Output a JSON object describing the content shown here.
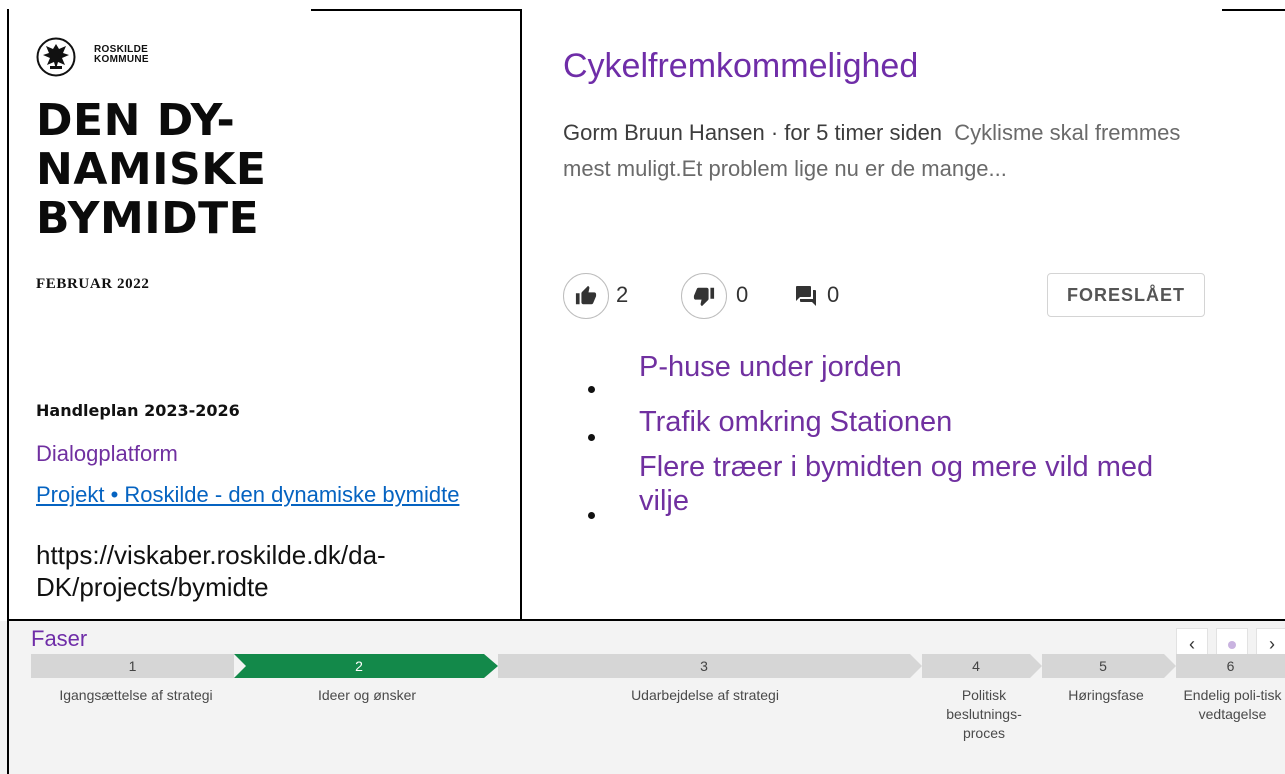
{
  "left": {
    "logo_text_line1": "ROSKILDE",
    "logo_text_line2": "KOMMUNE",
    "title_line1": "DEN DY-",
    "title_line2": "NAMISKE",
    "title_line3": "BYMIDTE",
    "date": "FEBRUAR 2022",
    "handleplan": "Handleplan 2023-2026",
    "dialog": "Dialogplatform",
    "project_link": "Projekt • Roskilde - den dynamiske bymidte",
    "url": "https://viskaber.roskilde.dk/da-DK/projects/bymidte"
  },
  "idea_card": {
    "title": "Cykelfremkommelighed",
    "author": "Gorm Bruun Hansen · for 5 timer siden",
    "excerpt": "Cyklisme skal fremmes mest muligt.Et problem lige nu er de mange...",
    "likes": "2",
    "dislikes": "0",
    "comments": "0",
    "status": "FORESLÅET"
  },
  "ideas": [
    "P-huse under jorden",
    "Trafik omkring Stationen",
    "Flere træer i bymidten og mere vild med vilje"
  ],
  "phases": {
    "title": "Faser",
    "nav_prev": "‹",
    "nav_next": "›",
    "items": [
      {
        "num": "1",
        "label": "Igangsættelse af strategi"
      },
      {
        "num": "2",
        "label": "Ideer og ønsker"
      },
      {
        "num": "3",
        "label": "Udarbejdelse af strategi"
      },
      {
        "num": "4",
        "label": "Politisk beslutnings-proces"
      },
      {
        "num": "5",
        "label": "Høringsfase"
      },
      {
        "num": "6",
        "label": "Endelig poli-tisk vedtagelse"
      }
    ],
    "active_color": "#13894a",
    "inactive_color": "#d6d6d6"
  }
}
